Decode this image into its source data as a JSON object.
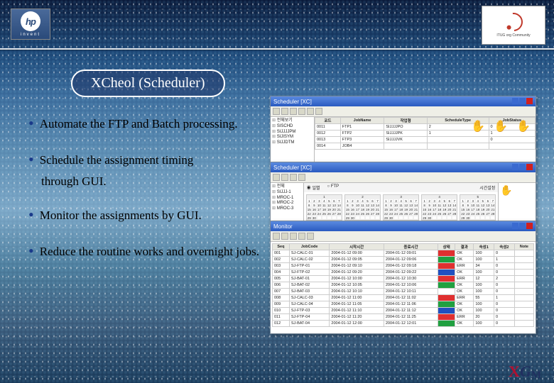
{
  "header": {
    "hp_invent": "invent",
    "corner_caption": "ITUG org Community"
  },
  "title": "XCheol (Scheduler)",
  "bullets": [
    "Automate the FTP and Batch processing.",
    "Schedule the assignment timing",
    "through GUI.",
    "Monitor the assignments by GUI.",
    "Reduce the routine works and overnight jobs."
  ],
  "shot1": {
    "title": "Scheduler [XC]",
    "tree": [
      "전체보기",
      "SISCHD",
      "SIJJJJPM",
      "SIJISYM",
      "SIJJDTM"
    ],
    "headers": [
      "코드",
      "JobName",
      "작업형",
      "ScheduleType",
      "JobStatus"
    ],
    "rows": [
      [
        "0011",
        "FTP1",
        "SIJJJJPO",
        "2",
        "0"
      ],
      [
        "0012",
        "FTP2",
        "SIJJJJPK",
        "1",
        "1"
      ],
      [
        "0013",
        "FTP3",
        "SIJJJJVK",
        "",
        "0"
      ],
      [
        "0014",
        "JOB4",
        "",
        "",
        ""
      ]
    ]
  },
  "shot2": {
    "title": "Scheduler [XC]",
    "tree": [
      "전체",
      "SIJJJ-1",
      "MROC-1",
      "MROC-2",
      "MROC-3"
    ],
    "panel_label": "시간설정",
    "radio1": "일별",
    "radio2": "FTP"
  },
  "shot3": {
    "title": "Monitor",
    "headers": [
      "Seq",
      "JobCode",
      "시작시간",
      "종료시간",
      "상태",
      "결과",
      "속성1",
      "속성2",
      "Note"
    ],
    "rows": [
      [
        "001",
        "SJ-CALC-01",
        "2004-01-12 09:00",
        "2004-01-12 09:01",
        "r",
        "OK",
        "100",
        "0",
        ""
      ],
      [
        "002",
        "SJ-CALC-02",
        "2004-01-12 09:05",
        "2004-01-12 09:06",
        "g",
        "OK",
        "100",
        "1",
        ""
      ],
      [
        "003",
        "SJ-FTP-01",
        "2004-01-12 09:10",
        "2004-01-12 09:18",
        "r",
        "ERR",
        "34",
        "0",
        ""
      ],
      [
        "004",
        "SJ-FTP-02",
        "2004-01-12 09:20",
        "2004-01-12 09:22",
        "b",
        "OK",
        "100",
        "0",
        ""
      ],
      [
        "005",
        "SJ-BAT-01",
        "2004-01-12 10:00",
        "2004-01-12 10:30",
        "r",
        "ERR",
        "12",
        "2",
        ""
      ],
      [
        "006",
        "SJ-BAT-02",
        "2004-01-12 10:05",
        "2004-01-12 10:06",
        "g",
        "OK",
        "100",
        "0",
        ""
      ],
      [
        "007",
        "SJ-BAT-03",
        "2004-01-12 10:10",
        "2004-01-12 10:11",
        "",
        "OK",
        "100",
        "0",
        ""
      ],
      [
        "008",
        "SJ-CALC-03",
        "2004-01-12 11:00",
        "2004-01-12 11:02",
        "r",
        "ERR",
        "55",
        "1",
        ""
      ],
      [
        "009",
        "SJ-CALC-04",
        "2004-01-12 11:05",
        "2004-01-12 11:06",
        "g",
        "OK",
        "100",
        "0",
        ""
      ],
      [
        "010",
        "SJ-FTP-03",
        "2004-01-12 11:10",
        "2004-01-12 11:12",
        "b",
        "OK",
        "100",
        "0",
        ""
      ],
      [
        "011",
        "SJ-FTP-04",
        "2004-01-12 11:20",
        "2004-01-12 11:25",
        "r",
        "ERR",
        "20",
        "0",
        ""
      ],
      [
        "012",
        "SJ-BAT-04",
        "2004-01-12 12:00",
        "2004-01-12 12:01",
        "g",
        "OK",
        "100",
        "0",
        ""
      ]
    ]
  },
  "footer": {
    "brand_x": "X",
    "brand_g": "G",
    "brand_m": "M",
    "tag": ""
  }
}
